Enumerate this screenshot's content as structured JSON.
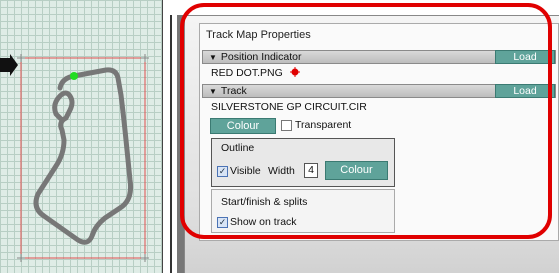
{
  "preview": {
    "background": "#dfece6",
    "track_color": "#777777",
    "marker_color": "#22dd22",
    "bounds_color": "#e05050"
  },
  "panel": {
    "title": "Track Map Properties",
    "position_indicator": {
      "header": "Position Indicator",
      "load_label": "Load",
      "file": "RED DOT.PNG",
      "dot_color": "#e00000"
    },
    "track": {
      "header": "Track",
      "load_label": "Load",
      "file": "SILVERSTONE GP CIRCUIT.CIR",
      "colour_label": "Colour",
      "transparent_label": "Transparent",
      "outline": {
        "title": "Outline",
        "visible_label": "Visible",
        "visible_checked": true,
        "width_label": "Width",
        "width_value": "4",
        "colour_label": "Colour"
      },
      "splits": {
        "title": "Start/finish & splits",
        "show_label": "Show on track",
        "show_checked": true
      }
    }
  },
  "highlight_color": "#e00000",
  "accent": "#5fa39a"
}
